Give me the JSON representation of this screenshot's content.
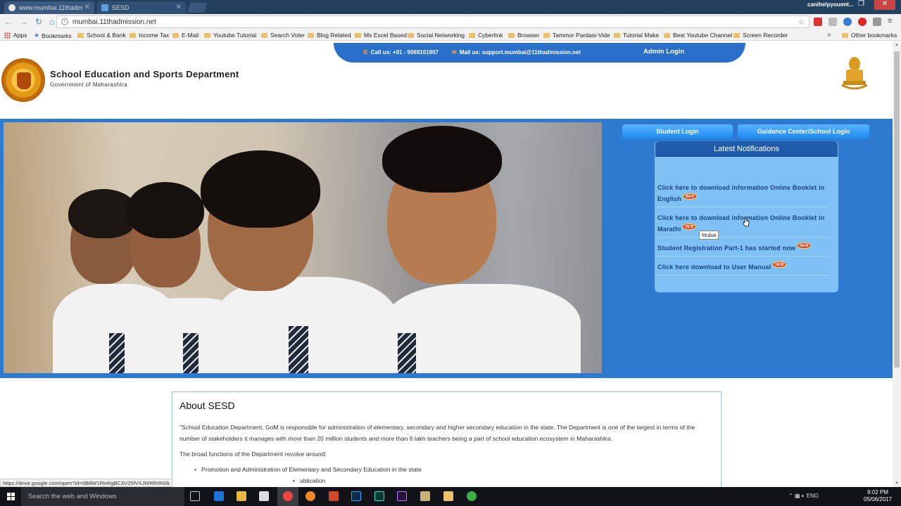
{
  "browser": {
    "tabs": [
      {
        "label": "www.mumbai.11thadm",
        "active": false
      },
      {
        "label": "SESD",
        "active": true
      }
    ],
    "profile": "canihelpyouonl...",
    "url": "mumbai.11thadmission.net",
    "bookmarks": [
      "Apps",
      "Bookmarks",
      "School & Bank",
      "Income Tax",
      "E-Mail",
      "Youtube Tutorial",
      "Search Voter",
      "Blog Related",
      "Ms Excel Based",
      "Social Networking",
      "Cyberlink",
      "Browser",
      "Tammor Pardasi-Vide",
      "Tutorial Make",
      "Best Youtube Channel",
      "Screen Recorder"
    ],
    "bookmarks_more": "»",
    "other_bookmarks": "Other bookmarks",
    "status_url": "https://drive.google.com/open?id=0B8W1Rb4IgBC3V25fVXJWRlh5N0k"
  },
  "site": {
    "title": "School Education and Sports Department",
    "subtitle": "Government of Maharashtra",
    "call": "Call us: +91 - 9069101907",
    "mail": "Mail us: support.mumbai@11thadmission.net",
    "admin_login": "Admin Login",
    "student_login": "Student Login",
    "guidance_login": "Guidance Center/School Login",
    "notifications": {
      "heading": "Latest Notifications",
      "badge": "NEW",
      "items": [
        "Click here to download information Online Booklet in English",
        "Click here to download information Online Booklet in Marathi",
        "Student Registration Part-1 has started now",
        "Click here download to User Manual"
      ]
    },
    "tooltip": "Mubai",
    "about": {
      "title": "About SESD",
      "paragraph": "\"School Education Department, GoM is responsible for administration of elementary, secondary and higher secondary education in the state. The Department is one of the largest in terms of the number of stakeholders it manages with more than 20 million students and more than 6 lakh teachers being a part of school education ecosystem in Maharashtra.",
      "intro": "The broad functions of the Department revolve around:",
      "bullets": [
        "Promotion and Administration of Elementary and Secondary Education in the state",
        "ublication"
      ]
    }
  },
  "taskbar": {
    "search_placeholder": "Search the web and Windows",
    "language": "ENG",
    "time": "8:02 PM",
    "date": "05/06/2017"
  },
  "colors": {
    "brand_blue": "#2e7ad0",
    "notif_panel": "#7fc1f5",
    "notif_header": "#1f5cad",
    "badge_red": "#e73b20"
  }
}
